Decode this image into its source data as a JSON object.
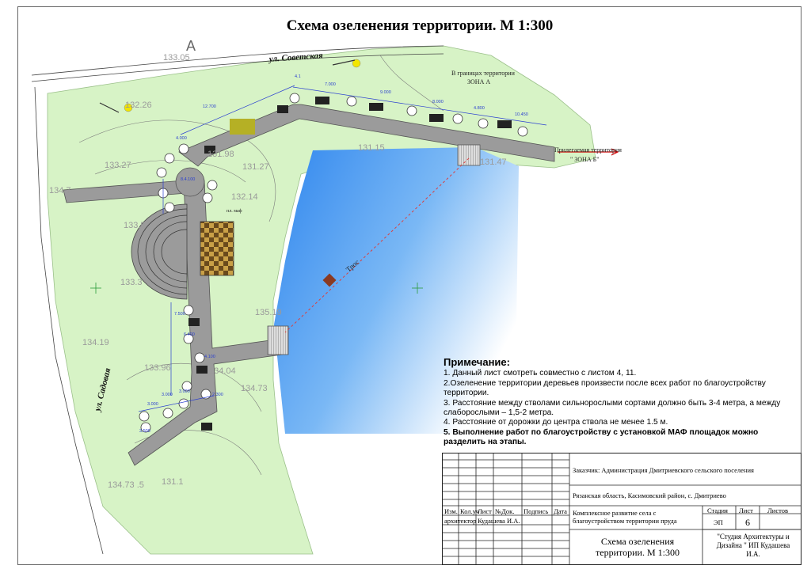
{
  "title": "Схема озеленения территории. М 1:300",
  "north_mark": "A",
  "map_labels": {
    "street_sovetskaya": "ул. Советская",
    "street_sadovaya": "ул. Садовая",
    "zone_a_line1": "В границах территории",
    "zone_a_line2": "ЗОНА А",
    "zone_b_line1": "Прилегаемая территория",
    "zone_b_line2": "\" ЗОНА Б\"",
    "tros": "Трос",
    "small_label": "пл. маф"
  },
  "elevations": [
    "133.05",
    "132.26",
    "133.27",
    "134.7",
    "131.98",
    "131.27",
    "132.14",
    "131.15",
    "131.47",
    "133.5",
    "133.3",
    "135.19",
    "134.19",
    "133.96",
    "134.04",
    "134.73",
    "134.73 .5",
    "131.1"
  ],
  "dimensions": [
    "7.000",
    "9.000",
    "8.000",
    "4.800",
    "10.450",
    "12.700",
    "4.000",
    "8.4.100",
    "4.1",
    "6.400",
    "7.500",
    "3.000",
    "2.300",
    "3.000",
    "3.000",
    "4.100",
    "3.500"
  ],
  "notes": {
    "heading": "Примечание:",
    "items": [
      "1. Данный лист смотреть совместно с листом 4, 11.",
      "2.Озеленение территории деревьев произвести после всех работ по благоустройству территории.",
      "3. Расстояние между стволами сильнорослыми сортами должно быть 3-4 метра, а между слаборослыми – 1,5-2 метра.",
      "4. Расстояние от дорожки до центра ствола не менее 1.5 м."
    ],
    "bold_item": "5. Выполнение работ по благоустройству с установкой МАФ площадок можно разделить на этапы."
  },
  "stamp": {
    "customer": "Заказчик: Администрация Дмитриевского сельского поселения",
    "location": "Рязанская область, Касимовский район, с. Дмитриево",
    "headers": [
      "Изм.",
      "Кол.уч",
      "Лист",
      "№Док.",
      "Подпись",
      "Дата"
    ],
    "role": "архитектор",
    "person": "Кудашева И.А.",
    "project": "Комплексное развитие села с благоустройством территории пруда",
    "stage_label": "Стадия",
    "sheet_label": "Лист",
    "sheets_label": "Листов",
    "stage": "ЭП",
    "sheet": "6",
    "drawing_name": "Схема озеленения территории. М 1:300",
    "studio": "\"Студия Архитектуры и Дизайна \" ИП Кудашева И.А."
  },
  "colors": {
    "grass": "#d9f5c9",
    "path": "#9a9a9a",
    "water": "#5ba0f0",
    "dimension": "#2a3fd0",
    "tree_dot": "#f3e800",
    "arrow": "#cc0000"
  }
}
